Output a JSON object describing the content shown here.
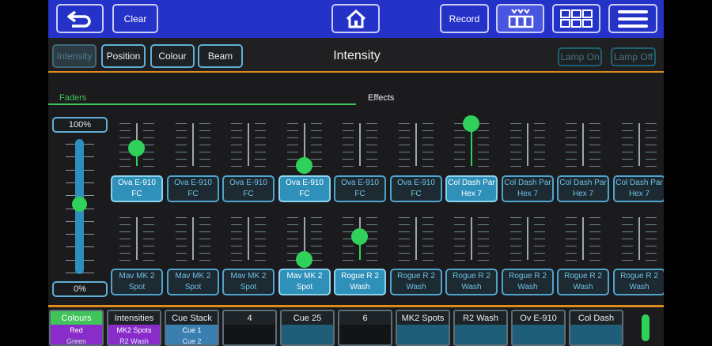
{
  "topbar": {
    "back_icon": "back-arrow-icon",
    "clear_label": "Clear",
    "home_icon": "home-icon",
    "record_label": "Record",
    "grid_view_icon": "grid-chevron-icon",
    "grid_icon": "grid-icon",
    "menu_icon": "hamburger-menu-icon"
  },
  "subbar": {
    "tabs": [
      {
        "label": "Intensity",
        "active": true
      },
      {
        "label": "Position",
        "active": false
      },
      {
        "label": "Colour",
        "active": false
      },
      {
        "label": "Beam",
        "active": false
      }
    ],
    "title": "Intensity",
    "lamp_on": "Lamp On",
    "lamp_off": "Lamp Off"
  },
  "sections": {
    "faders_label": "Faders",
    "effects_label": "Effects"
  },
  "master": {
    "top_label": "100%",
    "bottom_label": "0%",
    "level": 0.52
  },
  "fader_rows": [
    [
      {
        "line1": "Ova E-910 FC",
        "line2": "",
        "level": 0.42,
        "selected": true
      },
      {
        "line1": "Ova E-910 FC",
        "line2": "",
        "level": null,
        "selected": false
      },
      {
        "line1": "Ova E-910 FC",
        "line2": "",
        "level": null,
        "selected": false
      },
      {
        "line1": "Ova E-910 FC",
        "line2": "",
        "level": 0.02,
        "selected": true
      },
      {
        "line1": "Ova E-910 FC",
        "line2": "",
        "level": null,
        "selected": false
      },
      {
        "line1": "Ova E-910 FC",
        "line2": "",
        "level": null,
        "selected": false
      },
      {
        "line1": "Col Dash Par",
        "line2": "Hex 7",
        "level": 1.0,
        "selected": true
      },
      {
        "line1": "Col Dash Par",
        "line2": "Hex 7",
        "level": null,
        "selected": false
      },
      {
        "line1": "Col Dash Par",
        "line2": "Hex 7",
        "level": null,
        "selected": false
      },
      {
        "line1": "Col Dash Par",
        "line2": "Hex 7",
        "level": null,
        "selected": false
      }
    ],
    [
      {
        "line1": "Mav MK 2",
        "line2": "Spot",
        "level": null,
        "selected": false
      },
      {
        "line1": "Mav MK 2",
        "line2": "Spot",
        "level": null,
        "selected": false
      },
      {
        "line1": "Mav MK 2",
        "line2": "Spot",
        "level": null,
        "selected": false
      },
      {
        "line1": "Mav MK 2",
        "line2": "Spot",
        "level": 0.02,
        "selected": true
      },
      {
        "line1": "Rogue R 2",
        "line2": "Wash",
        "level": 0.55,
        "selected": true
      },
      {
        "line1": "Rogue R 2",
        "line2": "Wash",
        "level": null,
        "selected": false
      },
      {
        "line1": "Rogue R 2",
        "line2": "Wash",
        "level": null,
        "selected": false
      },
      {
        "line1": "Rogue R 2",
        "line2": "Wash",
        "level": null,
        "selected": false
      },
      {
        "line1": "Rogue R 2",
        "line2": "Wash",
        "level": null,
        "selected": false
      },
      {
        "line1": "Rogue R 2",
        "line2": "Wash",
        "level": null,
        "selected": false
      }
    ]
  ],
  "playbacks": [
    {
      "title": "Colours",
      "line1": "Red",
      "line2": "Green",
      "title_bg": "#3fc35a",
      "body_bg": "#8a2cc9"
    },
    {
      "title": "Intensities",
      "line1": "MK2 Spots",
      "line2": "R2 Wash",
      "title_bg": "",
      "body_bg": "#8a2cc9"
    },
    {
      "title": "Cue Stack",
      "line1": "Cue 1",
      "line2": "Cue 2",
      "title_bg": "",
      "body_bg": "#3a7fb0"
    },
    {
      "title": "4",
      "line1": "",
      "line2": "",
      "title_bg": "",
      "body_bg": ""
    },
    {
      "title": "Cue 25",
      "line1": "",
      "line2": "",
      "title_bg": "",
      "body_bg": "#1f5e78"
    },
    {
      "title": "6",
      "line1": "",
      "line2": "",
      "title_bg": "",
      "body_bg": ""
    },
    {
      "title": "MK2 Spots",
      "line1": "",
      "line2": "",
      "title_bg": "",
      "body_bg": "#1f5e78"
    },
    {
      "title": "R2 Wash",
      "line1": "",
      "line2": "",
      "title_bg": "",
      "body_bg": "#1f5e78"
    },
    {
      "title": "Ov E-910",
      "line1": "",
      "line2": "",
      "title_bg": "",
      "body_bg": "#1f5e78"
    },
    {
      "title": "Col Dash",
      "line1": "",
      "line2": "",
      "title_bg": "",
      "body_bg": "#1f5e78"
    }
  ],
  "colors": {
    "accent_green": "#2fd15a",
    "accent_orange": "#e08a1e",
    "topbar_blue": "#2532c8",
    "selected_blue": "#2f90b9"
  }
}
